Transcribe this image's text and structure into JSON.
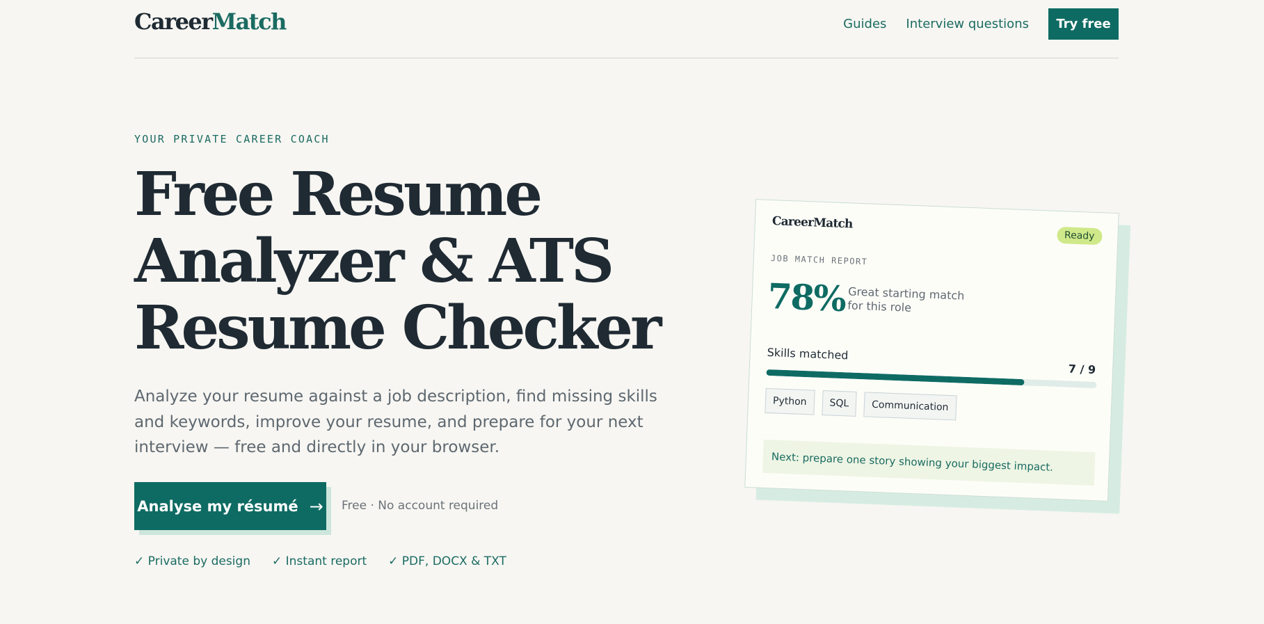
{
  "header": {
    "logo_part1": "Career",
    "logo_part2": "Match",
    "nav": [
      "Guides",
      "Interview questions"
    ],
    "try_label": "Try free"
  },
  "hero": {
    "eyebrow": "YOUR PRIVATE CAREER COACH",
    "title_lines": [
      "Free Resume",
      "Analyzer & ATS",
      "Resume Checker"
    ],
    "description": "Analyze your resume against a job description, find missing skills and keywords, improve your resume, and prepare for your next interview — free and directly in your browser.",
    "cta_label": "Analyse my résumé",
    "cta_arrow": "→",
    "cta_note": "Free · No account required",
    "features": [
      "✓ Private by design",
      "✓ Instant report",
      "✓ PDF, DOCX & TXT"
    ]
  },
  "report_card": {
    "logo": "CareerMatch",
    "status": "Ready",
    "label": "JOB MATCH REPORT",
    "score": "78%",
    "score_desc": "Great starting match for this role",
    "skills_label": "Skills matched",
    "skills_count": "7 / 9",
    "skills_progress": 0.78,
    "chips": [
      "Python",
      "SQL",
      "Communication"
    ],
    "next_step": "Next: prepare one story showing your biggest impact."
  },
  "colors": {
    "accent": "#0e6b63",
    "background": "#f7f6f2",
    "text": "#1f2a33",
    "ready_badge": "#cfe98a"
  },
  "icons": {
    "cta_arrow": "arrow-right-icon",
    "feature_check": "check-icon"
  }
}
